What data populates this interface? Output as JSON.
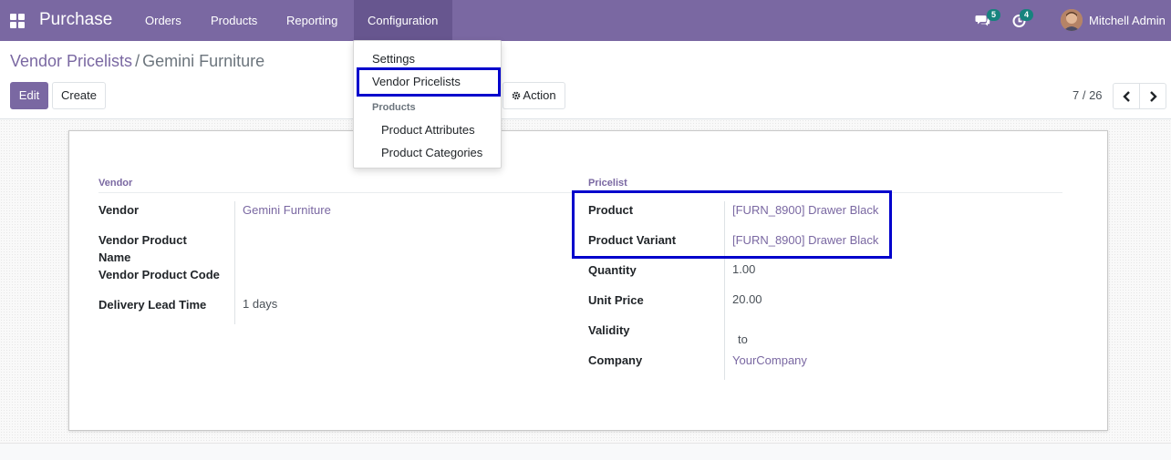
{
  "navbar": {
    "brand": "Purchase",
    "menus": [
      {
        "label": "Orders"
      },
      {
        "label": "Products"
      },
      {
        "label": "Reporting"
      },
      {
        "label": "Configuration"
      }
    ],
    "messages_count": "5",
    "activities_count": "4",
    "user": "Mitchell Admin",
    "color": "#7a68a2"
  },
  "dropdown": {
    "settings": "Settings",
    "vendor_pricelists": "Vendor Pricelists",
    "products_header": "Products",
    "product_attributes": "Product Attributes",
    "product_categories": "Product Categories"
  },
  "breadcrumb": {
    "parent": "Vendor Pricelists",
    "separator": "/",
    "current": "Gemini Furniture"
  },
  "buttons": {
    "edit": "Edit",
    "create": "Create",
    "action": "Action"
  },
  "pager": "7 / 26",
  "form": {
    "left": {
      "title": "Vendor",
      "vendor_label": "Vendor",
      "vendor_value": "Gemini Furniture",
      "vendor_product_name_label_1": "Vendor Product",
      "vendor_product_name_label_2": "Name",
      "vendor_product_code_label": "Vendor Product Code",
      "delivery_lead_time_label": "Delivery Lead Time",
      "delivery_lead_time_value": "1 days"
    },
    "right": {
      "title": "Pricelist",
      "product_label": "Product",
      "product_value": "[FURN_8900] Drawer Black",
      "product_variant_label": "Product Variant",
      "product_variant_value": "[FURN_8900] Drawer Black",
      "quantity_label": "Quantity",
      "quantity_value": "1.00",
      "unit_price_label": "Unit Price",
      "unit_price_value": "20.00",
      "validity_label": "Validity",
      "validity_value": "to",
      "company_label": "Company",
      "company_value": "YourCompany"
    }
  },
  "highlight_color": "#0000cc"
}
